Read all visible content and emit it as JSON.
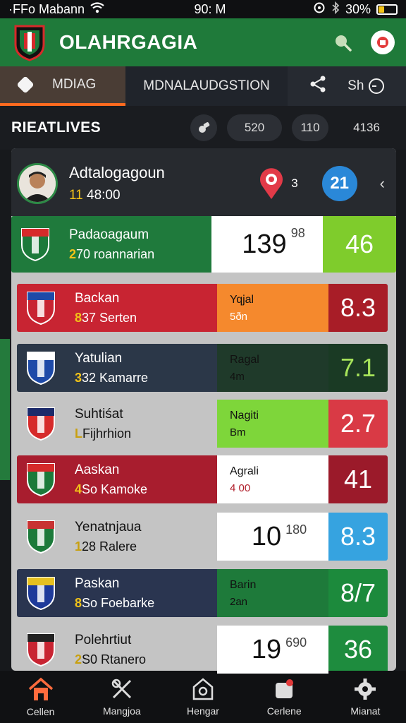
{
  "status_bar": {
    "carrier": "·FFo Mabann",
    "time": "90: M",
    "battery": "30%",
    "battery_level": 0.3
  },
  "app_bar": {
    "title": "OLAHRGAGIA"
  },
  "tabs": {
    "active": "MDIAG",
    "second": "MDNALAUDGSTION",
    "sh_label": "Sh"
  },
  "section": {
    "title": "RIEATLIVES",
    "pill1": "520",
    "pill2": "110",
    "pill3": "4136"
  },
  "player": {
    "name": "Adtalogagoun",
    "sub_bold": "11",
    "sub": "48:00",
    "pin_count": "3",
    "score": "21"
  },
  "rows": [
    {
      "name": "Padaoagaum",
      "sub_bold": "2",
      "sub": "70 roannarian",
      "mid_a": "139",
      "mid_b": "98",
      "value": "46",
      "left": "#1f7a3c",
      "mid": "#ffffff",
      "right": "#7fcc2c",
      "val_color": "#ffffff",
      "style": "big"
    },
    {
      "name": "Backan",
      "sub_bold": "8",
      "sub": "37 Serten",
      "mid_a": "Yqjal",
      "mid_b": "5ðn",
      "value": "8.3",
      "left": "#c82432",
      "mid": "#f5892d",
      "right": "#a81d27",
      "val_color": "#ffffff",
      "style": "small"
    },
    {
      "name": "Yatulian",
      "sub_bold": "3",
      "sub": "32 Kamarre",
      "mid_a": "Ragal",
      "mid_b": "4m",
      "value": "7.1",
      "left": "#2b3748",
      "mid": "#1f3a2a",
      "right": "#1a3a24",
      "val_color": "#a6e35a",
      "style": "small"
    },
    {
      "name": "Suhtiśat",
      "sub_bold": "L",
      "sub": "Fijhrhion",
      "mid_a": "Nagiti",
      "mid_b": "Bm",
      "value": "2.7",
      "left": "#c4c4c4",
      "mid": "#7ed63a",
      "right": "#d93a45",
      "val_color": "#ffffff",
      "style": "small",
      "dark_text": true
    },
    {
      "name": "Aaskan",
      "sub_bold": "4",
      "sub": "So Kamoke",
      "mid_a": "Agrali",
      "mid_b": "4 00",
      "value": "41",
      "left": "#a81d2e",
      "mid": "#ffffff",
      "right": "#9b1a2a",
      "val_color": "#ffffff",
      "style": "small"
    },
    {
      "name": "Yenatnjaua",
      "sub_bold": "1",
      "sub": "28 Ralere",
      "mid_a": "10",
      "mid_b": "180",
      "value": "8.3",
      "left": "#c4c4c4",
      "mid": "#ffffff",
      "right": "#36a3e0",
      "val_color": "#ffffff",
      "style": "big",
      "dark_text": true
    },
    {
      "name": "Paskan",
      "sub_bold": "8",
      "sub": "So Foebarke",
      "mid_a": "Barin",
      "mid_b": "2an",
      "value": "8/7",
      "left": "#2a3550",
      "mid": "#1e7a3a",
      "right": "#1c8a3c",
      "val_color": "#ffffff",
      "style": "small"
    },
    {
      "name": "Polehrtiut",
      "sub_bold": "2",
      "sub": "S0 Rtanero",
      "mid_a": "19",
      "mid_b": "690",
      "value": "36",
      "left": "#c4c4c4",
      "mid": "#ffffff",
      "right": "#1e8c3e",
      "val_color": "#ffffff",
      "style": "big",
      "dark_text": true
    }
  ],
  "bottom_nav": [
    {
      "label": "Cellen",
      "icon": "home-icon"
    },
    {
      "label": "Mangjoa",
      "icon": "tools-icon"
    },
    {
      "label": "Hengar",
      "icon": "hangar-icon"
    },
    {
      "label": "Cerlene",
      "icon": "notification-icon"
    },
    {
      "label": "Mianat",
      "icon": "settings-icon"
    }
  ]
}
